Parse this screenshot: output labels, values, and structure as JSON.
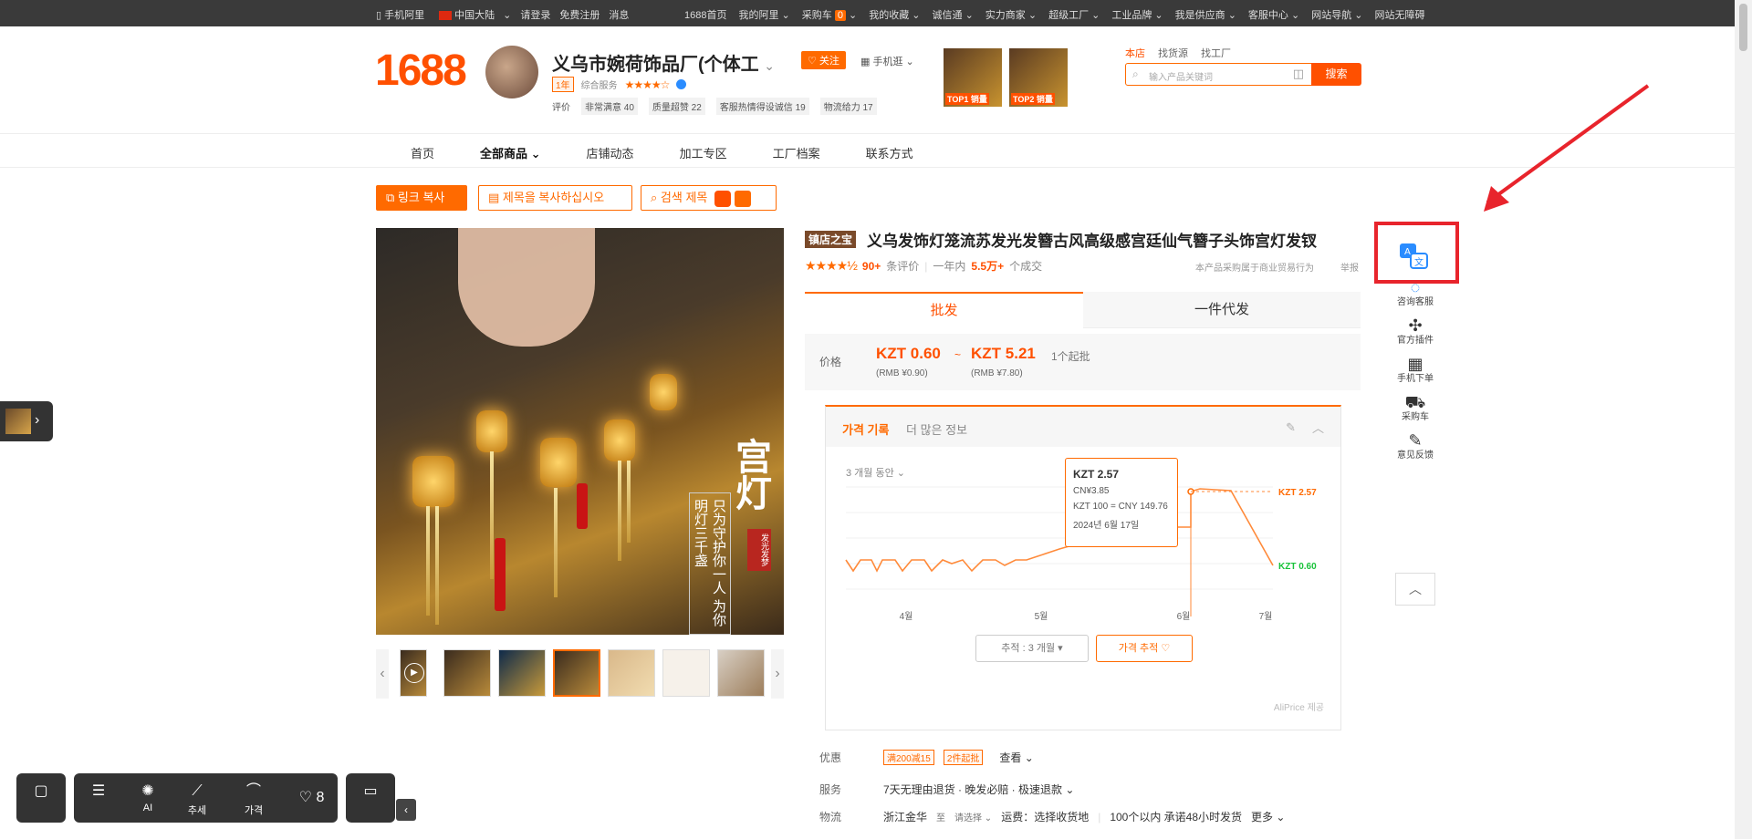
{
  "topbar": {
    "mobile": "手机阿里",
    "region": "中国大陆",
    "login": "请登录",
    "register": "免费注册",
    "messages": "消息",
    "links": [
      "1688首页",
      "我的阿里",
      "采购车",
      "我的收藏",
      "诚信通",
      "实力商家",
      "超级工厂",
      "工业品牌",
      "我是供应商",
      "客服中心",
      "网站导航",
      "网站无障碍"
    ],
    "cart_count": "0"
  },
  "header": {
    "logo": "1688",
    "shop_name": "义乌市婉荷饰品厂(个体工",
    "follow": "关注",
    "mobile_link": "手机逛",
    "years_tag": "1年",
    "service_label": "综合服务",
    "score_label": "评价",
    "scores": [
      "非常满意 40",
      "质量超赞 22",
      "客服热情得设诚信 19",
      "物流给力 17"
    ],
    "top_products": [
      "TOP1 销量",
      "TOP2 销量"
    ],
    "search_scope": [
      "本店",
      "找货源",
      "找工厂"
    ],
    "search_placeholder": "输入产品关键词",
    "search_button": "搜索"
  },
  "nav": {
    "items": [
      "首页",
      "全部商品",
      "店铺动态",
      "加工专区",
      "工厂档案",
      "联系方式"
    ]
  },
  "actions": {
    "copy_link": "링크 복사",
    "copy_title": "제목을 복사하십시오",
    "search_title": "검색 제목"
  },
  "product": {
    "image_text_big": "宫灯",
    "image_text_small": "只为守护你一人 为你明灯三千盏",
    "image_seal": "发光发梦",
    "badge": "镇店之宝",
    "title": "义乌发饰灯笼流苏发光发簪古风高级感宫廷仙气簪子头饰宫灯发钗",
    "rating_count": "90+",
    "rating_suffix": "条评价",
    "sales_prefix": "一年内",
    "sales_value": "5.5万+",
    "sales_suffix": "个成交",
    "biz_note": "本产品采购属于商业贸易行为",
    "report": "举报"
  },
  "tabs": {
    "wholesale": "批发",
    "dropship": "一件代发"
  },
  "price": {
    "label": "价格",
    "low": "KZT  0.60",
    "high": "KZT  5.21",
    "tilde": "~",
    "moq": "1个起批",
    "rmb_low": "(RMB ¥0.90)",
    "rmb_high": "(RMB ¥7.80)"
  },
  "price_history": {
    "title": "가격 기록",
    "more": "더 많은 정보",
    "range": "3 개월 동안",
    "tooltip_price": "KZT 2.57",
    "tooltip_cny": "CN¥3.85",
    "tooltip_rate": "KZT 100 = CNY 149.76",
    "tooltip_date": "2024년 6월 17일",
    "label_high": "KZT 2.57",
    "label_low": "KZT 0.60",
    "track_select": "추적 : 3 개월",
    "track_button": "가격 추적",
    "provider": "AliPrice 제공",
    "x_ticks": [
      "4월",
      "5월",
      "6월",
      "7월"
    ]
  },
  "info": {
    "discount_label": "优惠",
    "coupon1": "满200减15",
    "coupon2": "2件起批",
    "view": "查看",
    "service_label": "服务",
    "service_text": "7天无理由退货 · 晚发必赔 · 极速退款",
    "logistics_label": "物流",
    "origin": "浙江金华",
    "to": "至",
    "choose": "请选择",
    "freight": "运费：选择收货地",
    "ship_note": "100个以内 承诺48小时发货",
    "more": "更多"
  },
  "sidebar": {
    "items": [
      "咨询客服",
      "官方插件",
      "手机下单",
      "采购车",
      "意见反馈"
    ]
  },
  "bottom_toolbar": {
    "ai": "AI",
    "trend": "추세",
    "price": "가격",
    "likes": "8"
  },
  "colors": {
    "brand": "#ff5000",
    "accent": "#ff6a00",
    "highlight": "#e8242c",
    "low_price": "#19c23a"
  }
}
